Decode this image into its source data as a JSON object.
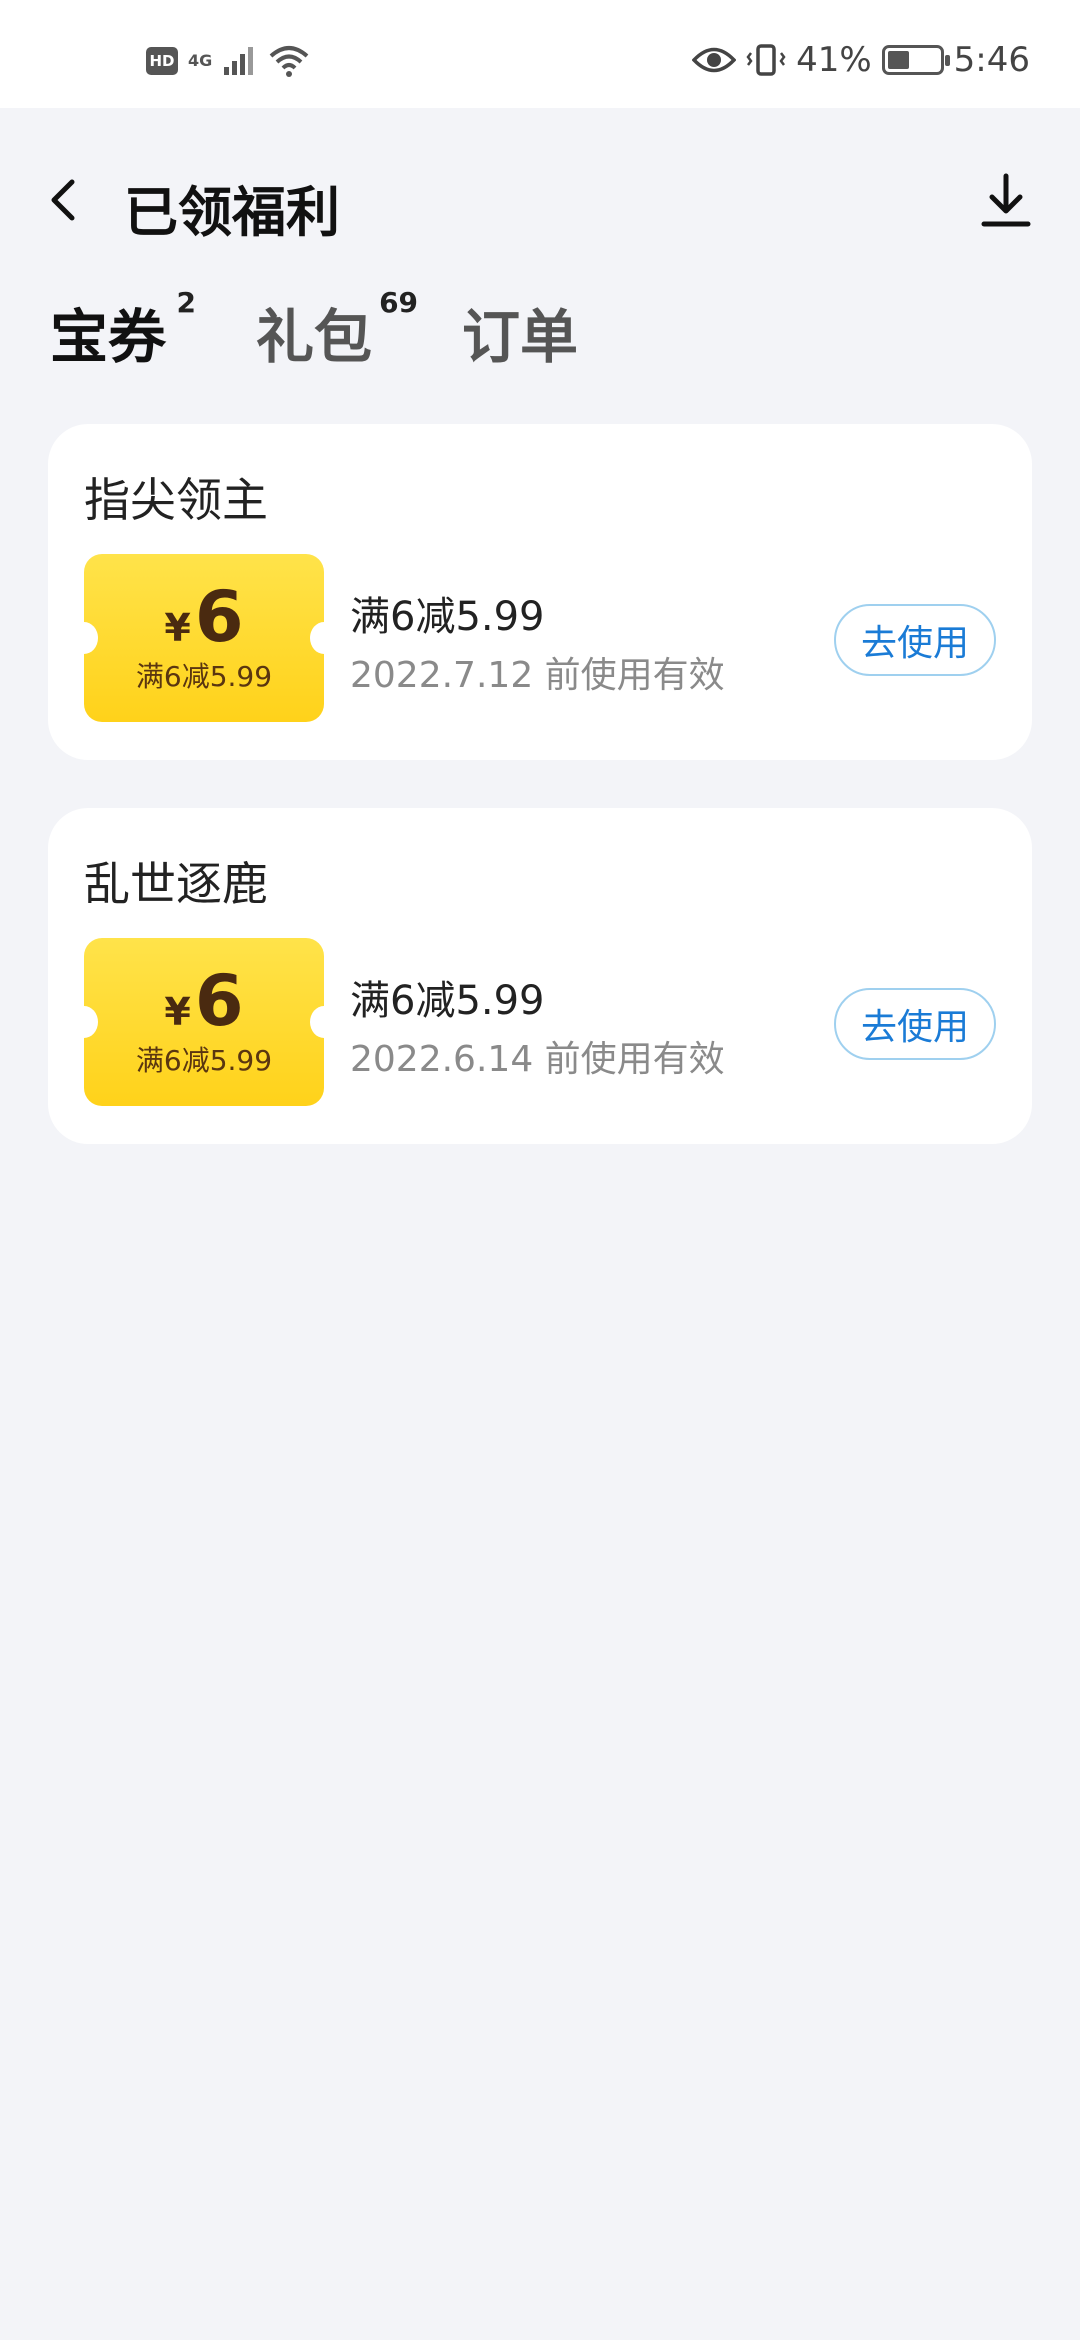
{
  "status_bar": {
    "hd": "HD",
    "network": "4G",
    "battery_percent": "41%",
    "battery_level": 0.41,
    "time": "5:46"
  },
  "header": {
    "title": "已领福利"
  },
  "tabs": [
    {
      "label": "宝券",
      "count": "2"
    },
    {
      "label": "礼包",
      "count": "69"
    },
    {
      "label": "订单",
      "count": ""
    }
  ],
  "coupons": [
    {
      "game": "指尖领主",
      "currency": "¥",
      "amount": "6",
      "badge_condition": "满6减5.99",
      "condition": "满6减5.99",
      "expiry": "2022.7.12 前使用有效",
      "action": "去使用"
    },
    {
      "game": "乱世逐鹿",
      "currency": "¥",
      "amount": "6",
      "badge_condition": "满6减5.99",
      "condition": "满6减5.99",
      "expiry": "2022.6.14 前使用有效",
      "action": "去使用"
    }
  ],
  "colors": {
    "coupon_yellow": "#ffd21a",
    "button_blue": "#1a7bd6",
    "background": "#f3f4f8"
  }
}
